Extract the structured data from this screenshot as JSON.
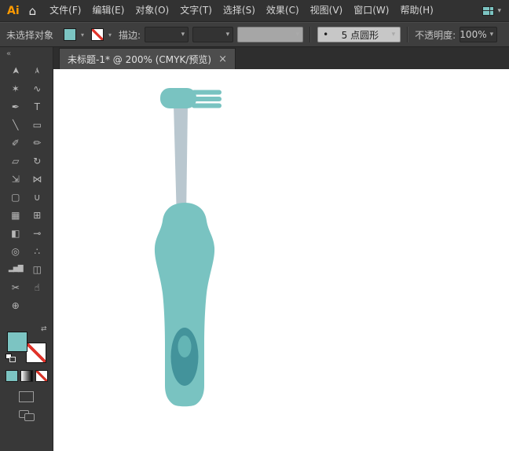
{
  "app": {
    "logo": "Ai"
  },
  "icons": {
    "home": "⌂",
    "chevron_down": "▾",
    "collapse": "«",
    "swap": "⇄"
  },
  "menubar": {
    "items": [
      {
        "label": "文件(F)"
      },
      {
        "label": "编辑(E)"
      },
      {
        "label": "对象(O)"
      },
      {
        "label": "文字(T)"
      },
      {
        "label": "选择(S)"
      },
      {
        "label": "效果(C)"
      },
      {
        "label": "视图(V)"
      },
      {
        "label": "窗口(W)"
      },
      {
        "label": "帮助(H)"
      }
    ]
  },
  "controlbar": {
    "selection_status": "未选择对象",
    "stroke_label": "描边:",
    "brush_bullet": "•",
    "brush_value": "5 点圆形",
    "opacity_label": "不透明度:",
    "opacity_value": "100%"
  },
  "tabbar": {
    "title": "未标题-1* @ 200% (CMYK/预览)",
    "close": "×"
  },
  "toolbar": {
    "tools": [
      {
        "name": "selection-tool",
        "glyph": "➤"
      },
      {
        "name": "direct-selection-tool",
        "glyph": "➢"
      },
      {
        "name": "magic-wand-tool",
        "glyph": "✶"
      },
      {
        "name": "lasso-tool",
        "glyph": "∿"
      },
      {
        "name": "pen-tool",
        "glyph": "✒"
      },
      {
        "name": "type-tool",
        "glyph": "T"
      },
      {
        "name": "line-segment-tool",
        "glyph": "╲"
      },
      {
        "name": "rectangle-tool",
        "glyph": "▭"
      },
      {
        "name": "paintbrush-tool",
        "glyph": "✐"
      },
      {
        "name": "pencil-tool",
        "glyph": "✏"
      },
      {
        "name": "eraser-tool",
        "glyph": "▱"
      },
      {
        "name": "rotate-tool",
        "glyph": "↻"
      },
      {
        "name": "scale-tool",
        "glyph": "⇲"
      },
      {
        "name": "width-tool",
        "glyph": "⋈"
      },
      {
        "name": "free-transform-tool",
        "glyph": "▢"
      },
      {
        "name": "shape-builder-tool",
        "glyph": "∪"
      },
      {
        "name": "perspective-grid-tool",
        "glyph": "▦"
      },
      {
        "name": "mesh-tool",
        "glyph": "⊞"
      },
      {
        "name": "gradient-tool",
        "glyph": "◧"
      },
      {
        "name": "eyedropper-tool",
        "glyph": "⊸"
      },
      {
        "name": "blend-tool",
        "glyph": "◎"
      },
      {
        "name": "symbol-sprayer-tool",
        "glyph": "∴"
      },
      {
        "name": "column-graph-tool",
        "glyph": "▂▅▇"
      },
      {
        "name": "artboard-tool",
        "glyph": "◫"
      },
      {
        "name": "slice-tool",
        "glyph": "✂"
      },
      {
        "name": "hand-tool",
        "glyph": "☝"
      },
      {
        "name": "zoom-tool",
        "glyph": "⊕"
      }
    ]
  },
  "colors": {
    "fill_teal": "#7CC4C2",
    "stroke_none_red": "#E0332A",
    "logo_orange": "#FF9A00"
  },
  "artwork": {
    "name": "electric toothbrush illustration",
    "zoom": "200%",
    "colors": {
      "body": "#79C3C1",
      "neck": "#B9C7CF",
      "button_outer": "#43939B",
      "button_inner": "#64B5B5"
    }
  }
}
